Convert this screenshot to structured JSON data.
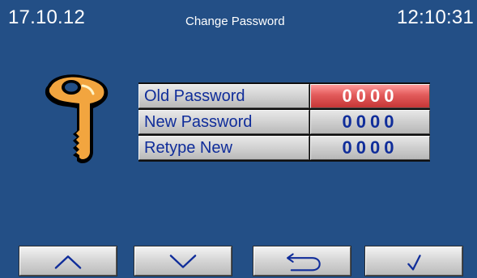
{
  "header": {
    "date": "17.10.12",
    "title": "Change Password",
    "time": "12:10:31"
  },
  "password_form": {
    "rows": [
      {
        "label": "Old Password",
        "value": "0000",
        "active": true
      },
      {
        "label": "New Password",
        "value": "0000",
        "active": false
      },
      {
        "label": "Retype New",
        "value": "0000",
        "active": false
      }
    ]
  },
  "footer": {
    "buttons": [
      {
        "icon": "chevron-up-icon"
      },
      {
        "icon": "chevron-down-icon"
      },
      {
        "icon": "return-arrow-icon"
      },
      {
        "icon": "checkmark-icon"
      }
    ]
  },
  "icons": {
    "key": "key-icon"
  },
  "colors": {
    "background": "#234f86",
    "label_text": "#102d9a",
    "active_field": "#e25b5b",
    "key": "#f2a53f"
  }
}
